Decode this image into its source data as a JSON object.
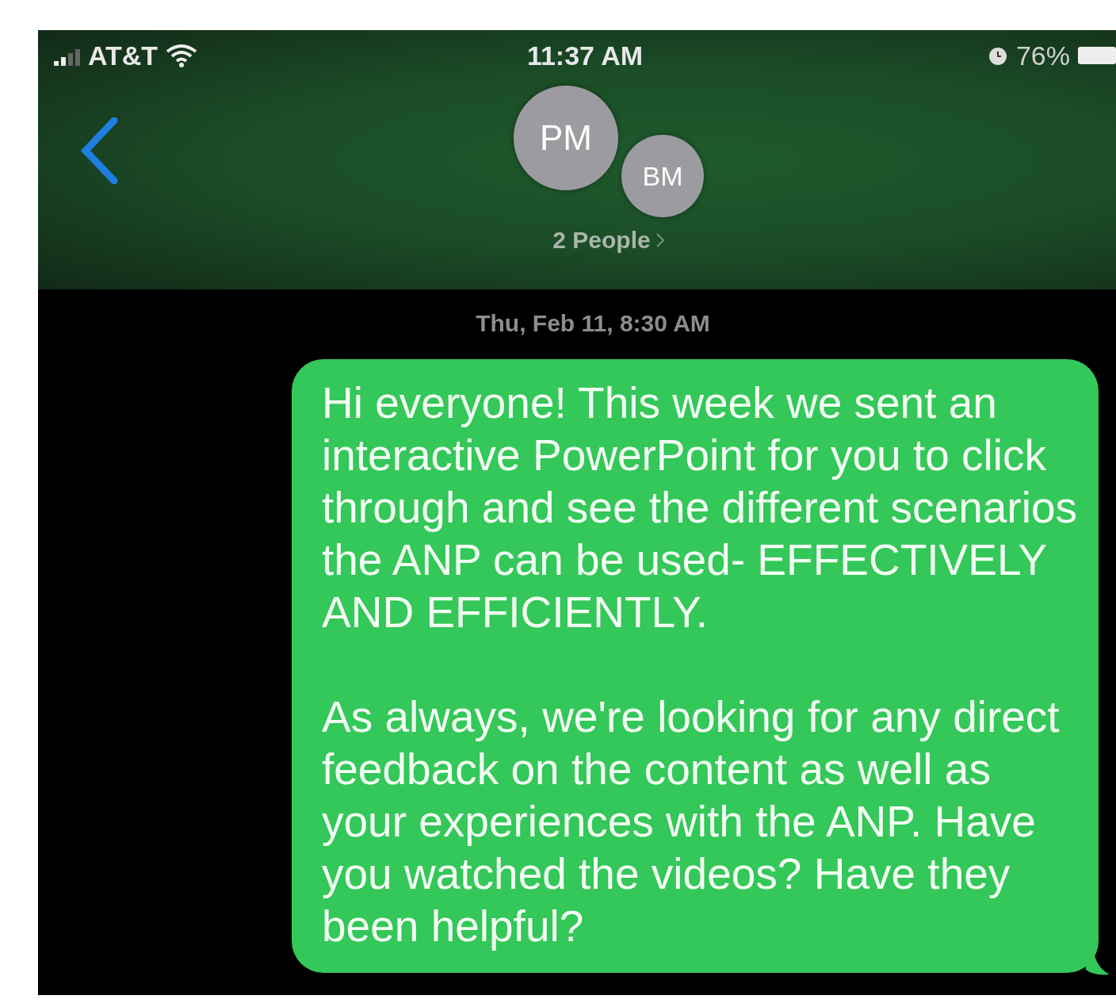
{
  "status_bar": {
    "carrier": "AT&T",
    "time": "11:37 AM",
    "battery": "76%"
  },
  "conversation": {
    "avatars": [
      "PM",
      "BM"
    ],
    "people": "2 People"
  },
  "timestamp": "Thu, Feb 11, 8:30 AM",
  "messages": [
    {
      "kind": "sent",
      "paragraphs": [
        "Hi everyone! This week we sent an interactive PowerPoint for you to click through and see the different scenarios the ANP can be used- EFFECTIVELY AND EFFICIENTLY.",
        "As always, we're looking for any direct feedback on the content as well as your experiences with the ANP. Have you watched the videos? Have they been helpful?"
      ]
    }
  ]
}
